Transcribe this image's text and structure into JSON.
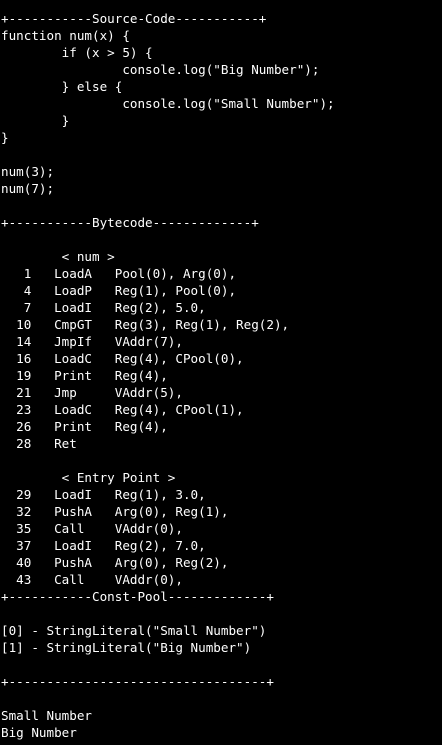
{
  "terminal": {
    "background": "#000000",
    "foreground": "#ffffff",
    "lines": [
      "+-----------Source-Code-----------+",
      "function num(x) {",
      "        if (x > 5) {",
      "                console.log(\"Big Number\");",
      "        } else {",
      "                console.log(\"Small Number\");",
      "        }",
      "}",
      "",
      "num(3);",
      "num(7);",
      "",
      "+-----------Bytecode-------------+",
      "",
      "        < num >",
      "   1   LoadA   Pool(0), Arg(0),",
      "   4   LoadP   Reg(1), Pool(0),",
      "   7   LoadI   Reg(2), 5.0,",
      "  10   CmpGT   Reg(3), Reg(1), Reg(2),",
      "  14   JmpIf   VAddr(7),",
      "  16   LoadC   Reg(4), CPool(0),",
      "  19   Print   Reg(4),",
      "  21   Jmp     VAddr(5),",
      "  23   LoadC   Reg(4), CPool(1),",
      "  26   Print   Reg(4),",
      "  28   Ret",
      "",
      "        < Entry Point >",
      "  29   LoadI   Reg(1), 3.0,",
      "  32   PushA   Arg(0), Reg(1),",
      "  35   Call    VAddr(0),",
      "  37   LoadI   Reg(2), 7.0,",
      "  40   PushA   Arg(0), Reg(2),",
      "  43   Call    VAddr(0),",
      "+-----------Const-Pool-------------+",
      "",
      "[0] - StringLiteral(\"Small Number\")",
      "[1] - StringLiteral(\"Big Number\")",
      "",
      "+----------------------------------+",
      "",
      "Small Number",
      "Big Number"
    ]
  }
}
